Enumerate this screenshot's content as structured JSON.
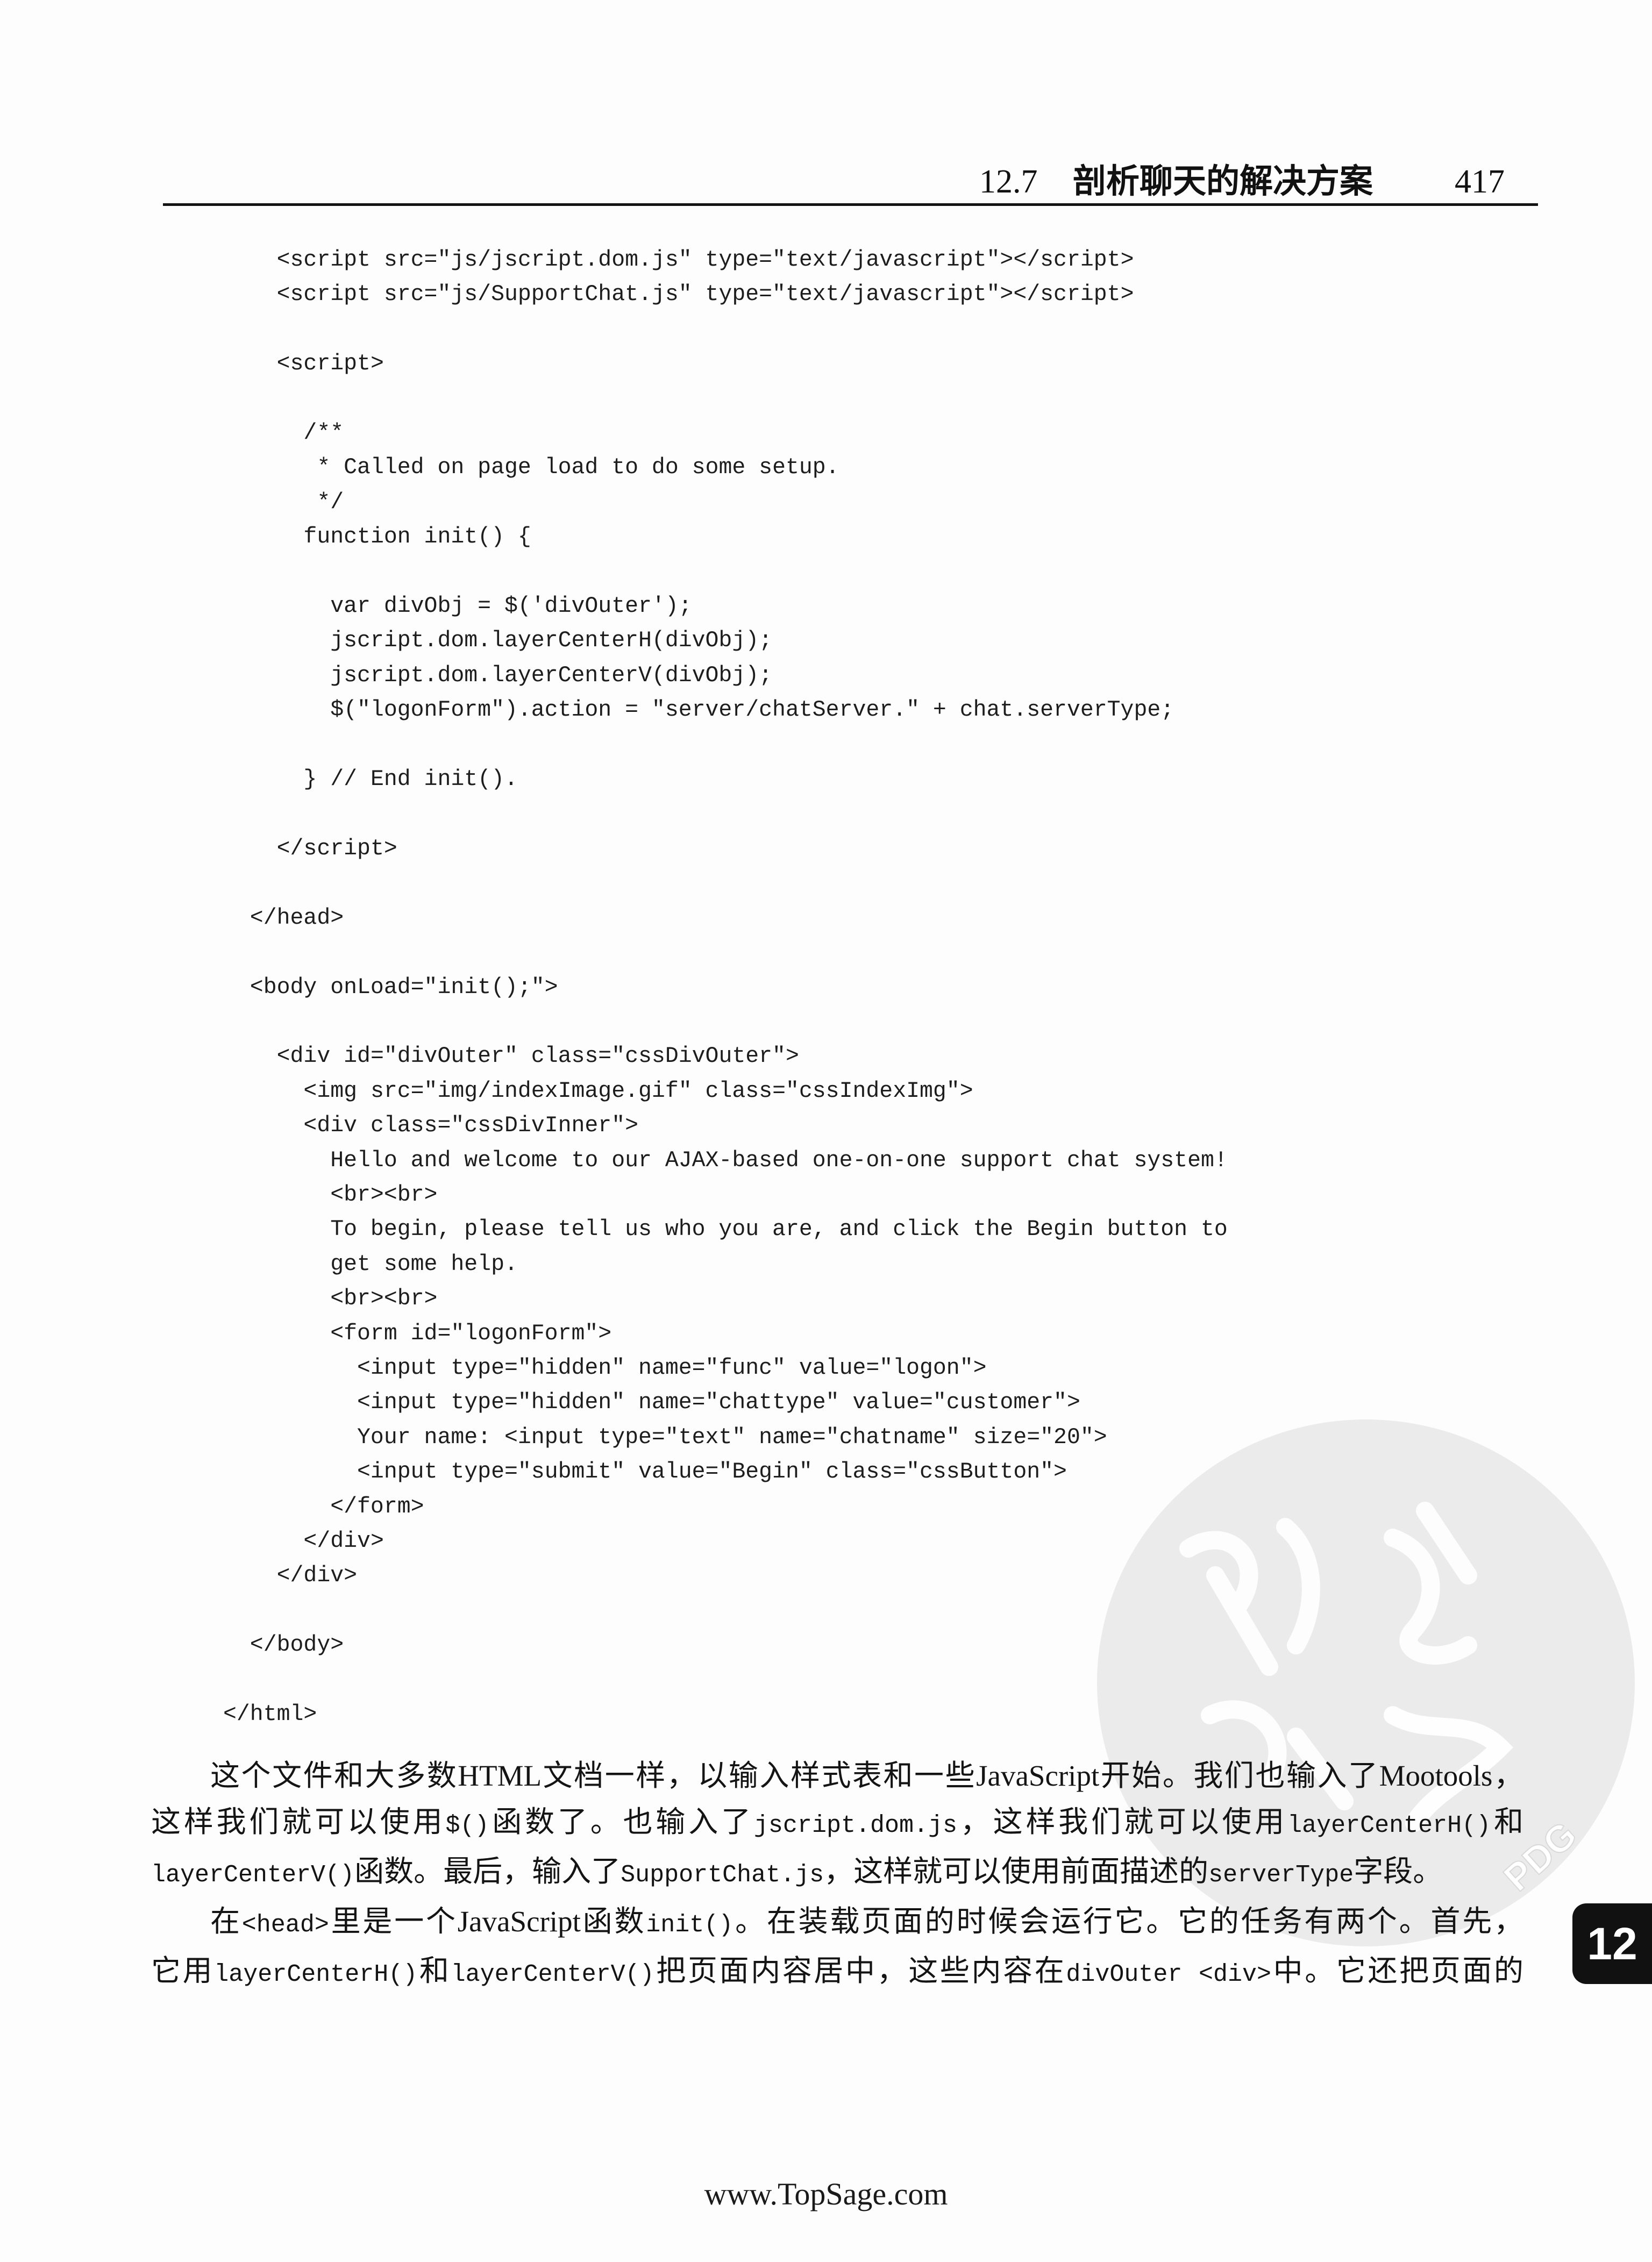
{
  "header": {
    "section_number": "12.7",
    "section_title": "剖析聊天的解决方案",
    "page_number": "417"
  },
  "code_lines": [
    "<script src=\"js/jscript.dom.js\" type=\"text/javascript\"></script>",
    "<script src=\"js/SupportChat.js\" type=\"text/javascript\"></script>",
    "<script>",
    "/**",
    "* Called on page load to do some setup.",
    "*/",
    "function init() {",
    "var divObj = $('divOuter');",
    "jscript.dom.layerCenterH(divObj);",
    "jscript.dom.layerCenterV(divObj);",
    "$(\"logonForm\").action = \"server/chatServer.\" + chat.serverType;",
    "} // End init().",
    "</script>",
    "</head>",
    "<body onLoad=\"init();\">",
    "<div id=\"divOuter\" class=\"cssDivOuter\">",
    "<img src=\"img/indexImage.gif\" class=\"cssIndexImg\">",
    "<div class=\"cssDivInner\">",
    "Hello and welcome to our AJAX-based one-on-one support chat system!",
    "<br><br>",
    "To begin, please tell us who you are, and click the Begin button to",
    "get some help.",
    "<br><br>",
    "<form id=\"logonForm\">",
    "<input type=\"hidden\" name=\"func\" value=\"logon\">",
    "<input type=\"hidden\" name=\"chattype\" value=\"customer\">",
    "Your name: <input type=\"text\" name=\"chatname\" size=\"20\">",
    "<input type=\"submit\" value=\"Begin\" class=\"cssButton\">",
    "</form>",
    "</div>",
    "</div>",
    "</body>",
    "</html>"
  ],
  "paragraphs": [
    [
      [
        "这个文件和大多数HTML文档一样，以输入样式表和一些JavaScript开始。我们也输入了Mootools，"
      ],
      [
        "这样我们就可以使用",
        "$()",
        "函数了。也输入了",
        "jscript.dom.js",
        "，这样我们就可以使用",
        "layerCenterH()",
        "和"
      ],
      [
        "layerCenterV()",
        "函数。最后，输入了",
        "SupportChat.js",
        "，这样就可以使用前面描述的",
        "serverType",
        "字段。"
      ]
    ],
    [
      [
        "在",
        "<head>",
        "里是一个JavaScript函数",
        "init()",
        "。在装载页面的时候会运行它。它的任务有两个。首先，"
      ],
      [
        "它用",
        "layerCenterH()",
        "和",
        "layerCenterV()",
        "把页面内容居中，这些内容在",
        "divOuter <div>",
        "中。它还把页面的"
      ]
    ]
  ],
  "footer": {
    "url": "www.TopSage.com"
  },
  "chapter_tab": {
    "number": "12"
  },
  "watermark": {
    "text": "PDG",
    "color": "#ebebeb"
  }
}
